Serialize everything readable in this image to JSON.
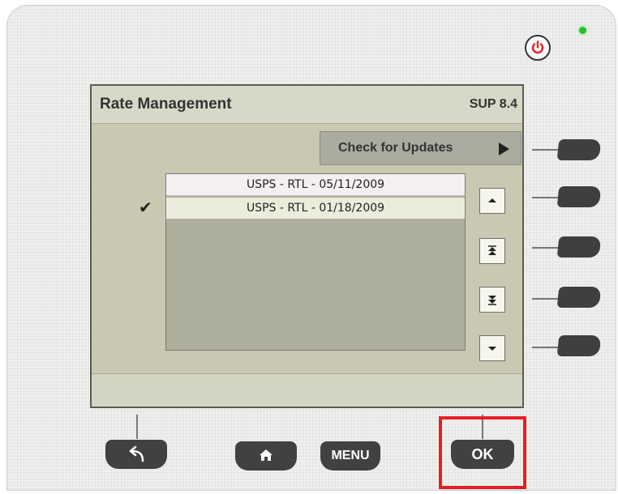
{
  "screen": {
    "title": "Rate Management",
    "version": "SUP 8.4",
    "check_updates_label": "Check for Updates",
    "rates": [
      {
        "label": "USPS - RTL - 05/11/2009",
        "selected": false
      },
      {
        "label": "USPS - RTL - 01/18/2009",
        "selected": true
      }
    ],
    "selected_mark": "✔"
  },
  "hardware": {
    "menu_label": "MENU",
    "ok_label": "OK"
  },
  "icons": {
    "power": "power-icon",
    "back": "back-arrow-icon",
    "home": "home-icon",
    "scroll_up": "chevron-up-icon",
    "page_up": "double-chevron-up-icon",
    "page_down": "double-chevron-down-icon",
    "scroll_down": "chevron-down-icon"
  },
  "colors": {
    "led": "#2bbf2b",
    "power": "#e81e25",
    "highlight": "#e81e25",
    "screen_bg": "#c8c8b3"
  }
}
